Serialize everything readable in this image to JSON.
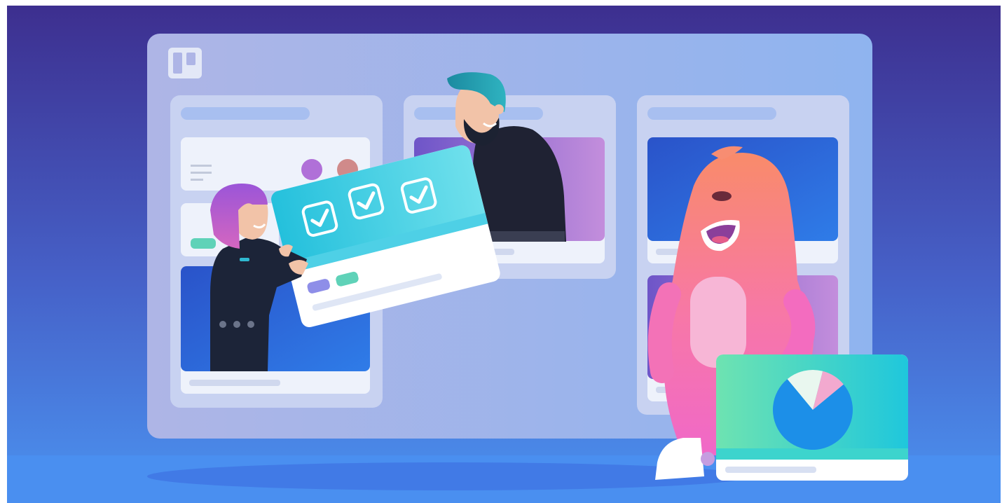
{
  "illustration": {
    "logo_icon": "trello-board-icon",
    "columns": [
      {
        "name": "board-column-left"
      },
      {
        "name": "board-column-middle"
      },
      {
        "name": "board-column-right"
      }
    ],
    "characters": [
      {
        "name": "woman-character"
      },
      {
        "name": "bearded-man-character"
      },
      {
        "name": "pink-mascot-character"
      }
    ],
    "featured_card": {
      "checked_items": 3,
      "label_colors": [
        "#8e8ee8",
        "#5fd2b8"
      ]
    },
    "pie_chart": {
      "slices": [
        0.75,
        0.15,
        0.1
      ],
      "colors": [
        "#1c8fe8",
        "#e9f7ef",
        "#f2a9cf"
      ]
    },
    "colors": {
      "background_top": "#3d2f8f",
      "background_bottom": "#4b93f0",
      "board": "#b5c7ef",
      "mascot": "#f78d72"
    }
  }
}
